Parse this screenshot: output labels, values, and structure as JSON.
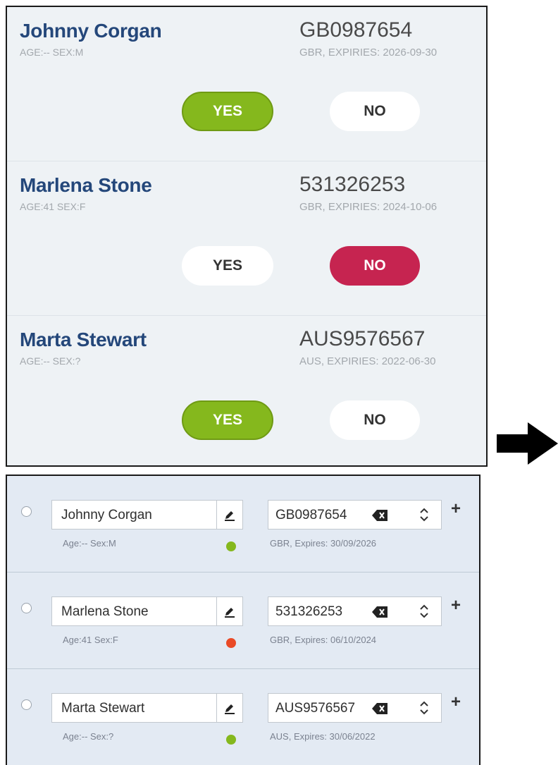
{
  "colors": {
    "accent_yes": "#85b81d",
    "accent_no": "#c62450",
    "status_ok": "#85b81d",
    "status_bad": "#ea4a26",
    "name_blue": "#24477a"
  },
  "top_panel": {
    "rows": [
      {
        "name": "Johnny Corgan",
        "meta": "AGE:-- SEX:M",
        "doc": "GB0987654",
        "expiry": "GBR, EXPIRIES: 2026-09-30",
        "yes_label": "YES",
        "no_label": "NO",
        "selected": "yes"
      },
      {
        "name": "Marlena Stone",
        "meta": "AGE:41 SEX:F",
        "doc": "531326253",
        "expiry": "GBR, EXPIRIES: 2024-10-06",
        "yes_label": "YES",
        "no_label": "NO",
        "selected": "no"
      },
      {
        "name": "Marta Stewart",
        "meta": "AGE:-- SEX:?",
        "doc": "AUS9576567",
        "expiry": "AUS, EXPIRIES: 2022-06-30",
        "yes_label": "YES",
        "no_label": "NO",
        "selected": "yes"
      }
    ]
  },
  "arrow_icon": "right-arrow-icon",
  "bottom_panel": {
    "rows": [
      {
        "name": "Johnny Corgan",
        "meta": "Age:-- Sex:M",
        "doc": "GB0987654",
        "expiry": "GBR, Expires: 30/09/2026",
        "status": "ok",
        "plus_label": "+"
      },
      {
        "name": "Marlena Stone",
        "meta": "Age:41 Sex:F",
        "doc": "531326253",
        "expiry": "GBR, Expires: 06/10/2024",
        "status": "bad",
        "plus_label": "+"
      },
      {
        "name": "Marta Stewart",
        "meta": "Age:-- Sex:?",
        "doc": "AUS9576567",
        "expiry": "AUS, Expires: 30/06/2022",
        "status": "ok",
        "plus_label": "+"
      }
    ]
  }
}
